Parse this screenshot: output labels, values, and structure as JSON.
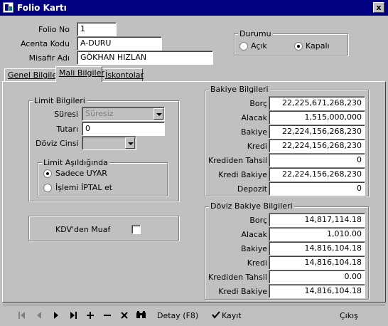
{
  "window": {
    "title": "Folio Kartı",
    "close_glyph": "x"
  },
  "header": {
    "folio_no_label": "Folio No",
    "folio_no_value": "1",
    "acenta_kodu_label": "Acenta Kodu",
    "acenta_kodu_value": "A-DURU",
    "misafir_adi_label": "Misafir Adı",
    "misafir_adi_value": "GÖKHAN HIZLAN"
  },
  "durumu": {
    "title": "Durumu",
    "options": [
      "Açık",
      "Kapalı"
    ],
    "selected": "Kapalı"
  },
  "tabs": [
    {
      "label": "Genel Bilgiler"
    },
    {
      "label": "Mali Bilgiler"
    },
    {
      "label": "İskontolar"
    }
  ],
  "active_tab": "Mali Bilgiler",
  "limit": {
    "title": "Limit Bilgileri",
    "suresi_label": "Süresi",
    "suresi_value": "Süresiz",
    "tutari_label": "Tutarı",
    "tutari_value": "0",
    "doviz_cinsi_label": "Döviz Cinsi",
    "doviz_cinsi_value": "",
    "asildiginda_title": "Limit Aşıldığında",
    "asildiginda_options": [
      "Sadece UYAR",
      "İşlemi İPTAL et"
    ],
    "asildiginda_selected": "Sadece UYAR"
  },
  "kdv": {
    "label": "KDV'den Muaf",
    "checked": false
  },
  "bakiye": {
    "title": "Bakiye Bilgileri",
    "rows": [
      {
        "label": "Borç",
        "value": "22,225,671,268,230"
      },
      {
        "label": "Alacak",
        "value": "1,515,000,000"
      },
      {
        "label": "Bakiye",
        "value": "22,224,156,268,230"
      },
      {
        "label": "Kredi",
        "value": "22,224,156,268,230"
      },
      {
        "label": "Krediden Tahsil",
        "value": "0"
      },
      {
        "label": "Kredi Bakiye",
        "value": "22,224,156,268,230"
      },
      {
        "label": "Depozit",
        "value": "0"
      }
    ]
  },
  "doviz_bakiye": {
    "title": "Döviz Bakiye Bilgileri",
    "rows": [
      {
        "label": "Borç",
        "value": "14,817,114.18"
      },
      {
        "label": "Alacak",
        "value": "1,010.00"
      },
      {
        "label": "Bakiye",
        "value": "14,816,104.18"
      },
      {
        "label": "Kredi",
        "value": "14,816,104.18"
      },
      {
        "label": "Krediden Tahsil",
        "value": "0.00"
      },
      {
        "label": "Kredi Bakiye",
        "value": "14,816,104.18"
      }
    ]
  },
  "toolbar": {
    "nav_icons": [
      "first-record-icon",
      "prior-record-icon",
      "next-record-icon",
      "last-record-icon",
      "insert-icon",
      "delete-icon",
      "cancel-icon",
      "find-icon"
    ],
    "detay_label": "Detay (F8)",
    "kayit_label": "Kayıt",
    "cikis_label": "Çıkış"
  }
}
